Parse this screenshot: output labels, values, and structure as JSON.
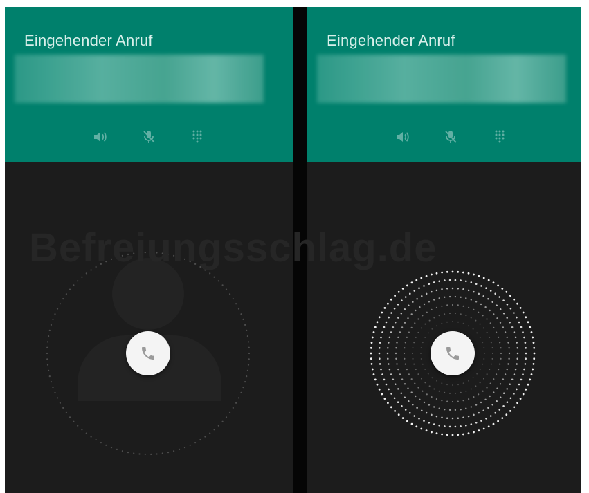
{
  "screens": [
    {
      "id": "left",
      "title": "Eingehender Anruf",
      "controls": [
        "speaker-icon",
        "mute-icon",
        "dialpad-icon"
      ],
      "answer_icon": "phone-icon",
      "ring_state": "idle"
    },
    {
      "id": "right",
      "title": "Eingehender Anruf",
      "controls": [
        "speaker-icon",
        "mute-icon",
        "dialpad-icon"
      ],
      "answer_icon": "phone-icon",
      "ring_state": "ringing"
    }
  ],
  "watermark": "Befreiungsschlag.de",
  "colors": {
    "header": "#00806c",
    "body": "#1c1c1c",
    "title": "#d8efea",
    "answer_button": "#f4f4f4",
    "phone_glyph": "#9a9a9a"
  }
}
